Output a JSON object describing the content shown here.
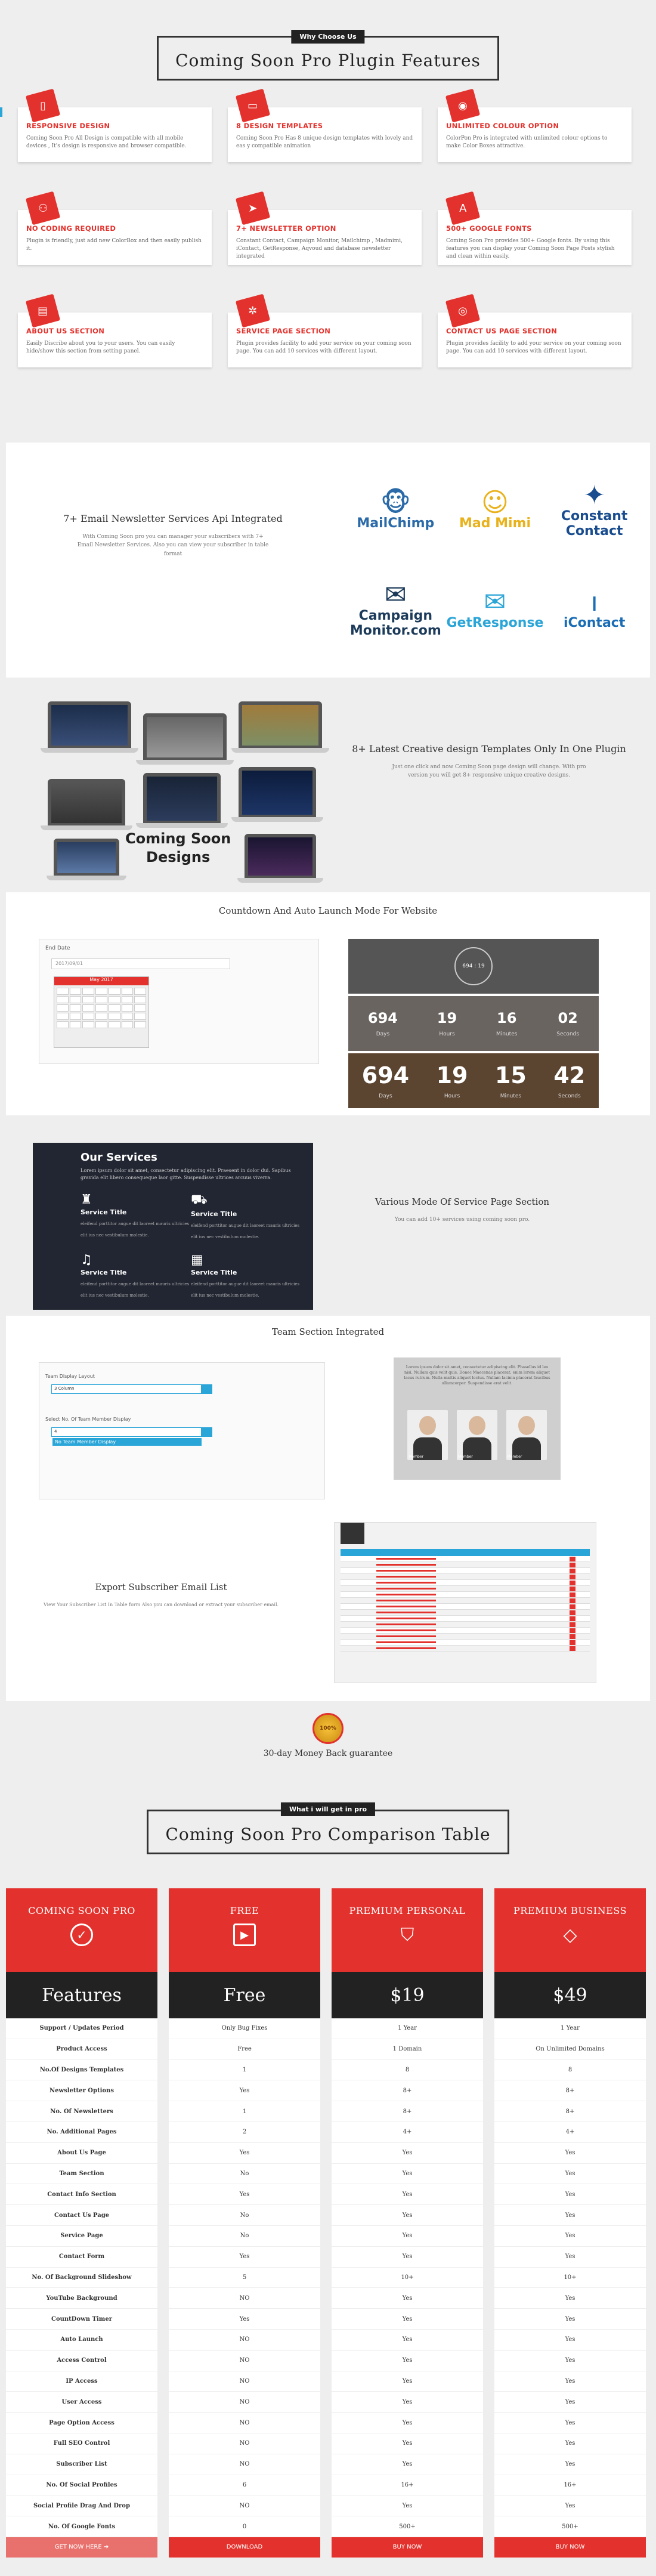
{
  "why": {
    "tag": "Why Choose Us",
    "title": "Coming Soon Pro Plugin Features"
  },
  "features": [
    {
      "title": "RESPONSIVE DESIGN",
      "icon": "mobile-icon",
      "glyph": "▯",
      "text": "Coming Soon Pro All Design is compatible with all mobile devices , It's design is responsive and browser compatible."
    },
    {
      "title": "8 DESIGN TEMPLATES",
      "icon": "laptop-icon",
      "glyph": "▭",
      "text": "Coming Soon Pro Has 8 unique design templates with lovely and eas y compatible animation"
    },
    {
      "title": "UNLIMITED COLOUR OPTION",
      "icon": "palette-icon",
      "glyph": "◉",
      "text": "ColorPon Pro is integrated with unlimited colour options to make Color Boxes attractive."
    },
    {
      "title": "NO CODING REQUIRED",
      "icon": "gamepad-icon",
      "glyph": "⚇",
      "text": "Plugin is friendly, just add new ColorBox and then easily publish it."
    },
    {
      "title": "7+ NEWSLETTER OPTION",
      "icon": "paper-plane-icon",
      "glyph": "➤",
      "text": "Constant Contact, Campaign Monitor, Mailchimp , Madmimi, iContact, GetResponse, Aqvoud and database newsletter integrated"
    },
    {
      "title": "500+ GOOGLE FONTS",
      "icon": "font-icon",
      "glyph": "A",
      "text": "Coming Soon Pro provides 500+ Google fonts. By using this features you can display your Coming Soon Page Posts stylish and clean within easily."
    },
    {
      "title": "ABOUT US SECTION",
      "icon": "id-card-icon",
      "glyph": "▤",
      "text": "Easily Discribe about you to your users. You can easily hide/show this section from setting panel."
    },
    {
      "title": "SERVICE PAGE SECTION",
      "icon": "gear-icon",
      "glyph": "✲",
      "text": "Plugin provides facility to add your service on your coming soon page. You can add 10 services with different layout."
    },
    {
      "title": "CONTACT US PAGE SECTION",
      "icon": "camera-icon",
      "glyph": "◎",
      "text": "Plugin provides facility to add your service on your coming soon page. You can add 10 services with different layout."
    }
  ],
  "email": {
    "title": "7+ Email Newsletter Services Api Integrated",
    "text": "With Coming Soon pro you can manager your subscribers with 7+ Email Newsletter Services. Also you can view your subscriber in table format",
    "logos": [
      {
        "name": "MailChimp",
        "icon": "mailchimp-monkey-icon",
        "glyph": "🐵",
        "color": "#2a6aa8"
      },
      {
        "name": "Mad Mimi",
        "icon": "madmimi-face-icon",
        "glyph": "☺",
        "color": "#e9b21c"
      },
      {
        "name": "Constant Contact",
        "icon": "constant-contact-icon",
        "glyph": "✦",
        "color": "#1a4d8f"
      },
      {
        "name": "Campaign Monitor.com",
        "icon": "campaign-monitor-icon",
        "glyph": "✉",
        "color": "#1c3b5a"
      },
      {
        "name": "GetResponse",
        "icon": "getresponse-icon",
        "glyph": "✉",
        "color": "#2aa5d8"
      },
      {
        "name": "iContact",
        "icon": "icontact-icon",
        "glyph": "ı",
        "color": "#1a6db5"
      }
    ]
  },
  "templates": {
    "title": "8+ Latest Creative design Templates Only In One Plugin",
    "text": "Just one click and now Coming Soon page design will change. With pro version you will get 8+ responsive unique creative designs.",
    "label_line1": "Coming Soon",
    "label_line2": "Designs"
  },
  "countdown": {
    "title": "Countdown And Auto Launch Mode For Website",
    "field_label": "End Date",
    "field_value": "2017/09/01",
    "cal_header": "May 2017",
    "row1": [
      {
        "v": "694",
        "l": "Days"
      },
      {
        "v": "19",
        "l": "Hours"
      },
      {
        "v": "16",
        "l": "Minutes"
      },
      {
        "v": "02",
        "l": "Seconds"
      }
    ],
    "row2": [
      {
        "v": "694",
        "l": "Days"
      },
      {
        "v": "19",
        "l": "Hours"
      },
      {
        "v": "15",
        "l": "Minutes"
      },
      {
        "v": "42",
        "l": "Seconds"
      }
    ],
    "circle_text": "694 : 19"
  },
  "services": {
    "heading": "Our Services",
    "intro": "Lorem ipsum dolor sit amet, consectetur adipiscing elit. Praesent in dolor dui. Sapibus gravida elit libero consequeque laor gitte. Suspendisse ultrices arcuus viverra.",
    "items": [
      {
        "title": "Service Title",
        "icon": "android-icon",
        "glyph": "♜",
        "text": "eleifend porttitor augue dit laoreet mauris ultricies elit ius nec vestibulum molestie."
      },
      {
        "title": "Service Title",
        "icon": "car-icon",
        "glyph": "⛟",
        "text": "eleifend porttitor augue dit laoreet mauris ultricies elit ius nec vestibulum molestie."
      },
      {
        "title": "Service Title",
        "icon": "bell-icon",
        "glyph": "♫",
        "text": "eleifend porttitor augue dit laoreet mauris ultricies elit ius nec vestibulum molestie."
      },
      {
        "title": "Service Title",
        "icon": "calendar-icon",
        "glyph": "▦",
        "text": "eleifend porttitor augue dit laoreet mauris ultricies elit ius nec vestibulum molestie."
      }
    ],
    "title": "Various Mode Of Service Page Section",
    "text": "You can add 10+ services using coming soon pro."
  },
  "team": {
    "title": "Team Section Integrated",
    "label1": "Team Display Layout",
    "value1": "3 Column",
    "label2": "Select No. Of Team Member Display",
    "value2": "4",
    "option": "No Team Member Display",
    "preview_text": "Lorem ipsum dolor sit amet, consectetur adipiscing elit. Phasellus id leo nisi. Nullam quis velit quis. Donec Maecenas placerat, enim lorem aliquet lacus rutrum. Nulla mattis aliquet lectus. Nullam lacinia placerat faucibus ullamcorper. Suspendisse erat velit.",
    "members": [
      "Member",
      "Member",
      "Member"
    ]
  },
  "export": {
    "title": "Export Subscriber Email List",
    "text": "View Your Subscriber List In Table form Also you can download or extract your subscriber email."
  },
  "guarantee": {
    "badge": "100%",
    "text": "30-day Money Back guarantee"
  },
  "compare": {
    "tag": "What i will get in pro",
    "title": "Coming Soon Pro Comparison Table",
    "columns": [
      {
        "name": "COMING SOON PRO",
        "icon": "check-circle-icon",
        "glyph": "✓",
        "price": "Features",
        "button": "GET NOW HERE ➔",
        "cells": [
          "Support / Updates Period",
          "Product Access",
          "No.Of Designs Templates",
          "Newsletter Options",
          "No. Of Newsletters",
          "No. Additional Pages",
          "About Us Page",
          "Team Section",
          "Contact Info Section",
          "Contact Us Page",
          "Service Page",
          "Contact Form",
          "No. Of Background Slideshow",
          "YouTube Background",
          "CountDown Timer",
          "Auto Launch",
          "Access Control",
          "IP Access",
          "User Access",
          "Page Option Access",
          "Full SEO Control",
          "Subscriber List",
          "No. Of Social Profiles",
          "Social Profile Drag And Drop",
          "No. Of Google Fonts"
        ]
      },
      {
        "name": "FREE",
        "icon": "play-square-icon",
        "glyph": "▶",
        "price": "Free",
        "button": "DOWNLOAD",
        "cells": [
          "Only Bug Fixes",
          "Free",
          "1",
          "Yes",
          "1",
          "2",
          "Yes",
          "No",
          "Yes",
          "No",
          "No",
          "Yes",
          "5",
          "NO",
          "Yes",
          "NO",
          "NO",
          "NO",
          "NO",
          "NO",
          "NO",
          "NO",
          "6",
          "NO",
          "0"
        ]
      },
      {
        "name": "PREMIUM PERSONAL",
        "icon": "shield-icon",
        "glyph": "⛉",
        "price": "$19",
        "button": "BUY NOW",
        "cells": [
          "1 Year",
          "1 Domain",
          "8",
          "8+",
          "8+",
          "4+",
          "Yes",
          "Yes",
          "Yes",
          "Yes",
          "Yes",
          "Yes",
          "10+",
          "Yes",
          "Yes",
          "Yes",
          "Yes",
          "Yes",
          "Yes",
          "Yes",
          "Yes",
          "Yes",
          "16+",
          "Yes",
          "500+"
        ]
      },
      {
        "name": "PREMIUM BUSINESS",
        "icon": "diamond-icon",
        "glyph": "◇",
        "price": "$49",
        "button": "BUY NOW",
        "cells": [
          "1 Year",
          "On Unlimited Domains",
          "8",
          "8+",
          "8+",
          "4+",
          "Yes",
          "Yes",
          "Yes",
          "Yes",
          "Yes",
          "Yes",
          "10+",
          "Yes",
          "Yes",
          "Yes",
          "Yes",
          "Yes",
          "Yes",
          "Yes",
          "Yes",
          "Yes",
          "16+",
          "Yes",
          "500+"
        ]
      }
    ]
  }
}
